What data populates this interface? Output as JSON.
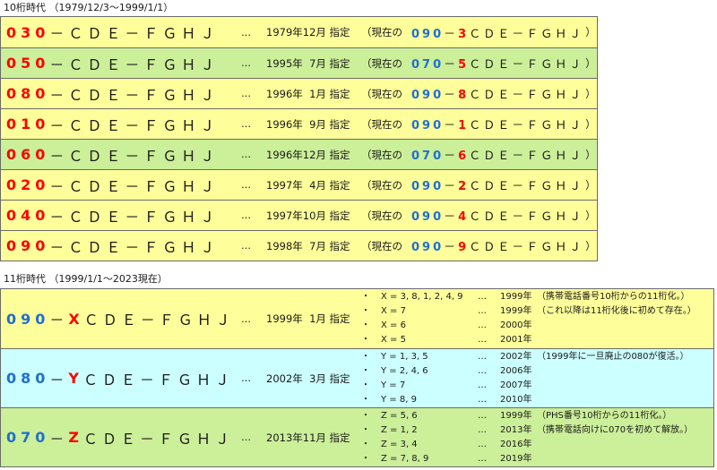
{
  "section10": {
    "heading": "10桁時代 （1979/12/3～1999/1/1）",
    "rows": [
      {
        "prefix": "030",
        "rest": "－ＣＤＥ－ＦＧＨＪ",
        "dots": "…",
        "date": "1979年12月 指定",
        "cur_open": "（現在の",
        "cur_prefix": "090",
        "cur_dash": "－",
        "cur_digit": "3",
        "cur_rest": "ＣＤＥ－ＦＧＨＪ",
        "cur_close": "）",
        "color": "yellow"
      },
      {
        "prefix": "050",
        "rest": "－ＣＤＥ－ＦＧＨＪ",
        "dots": "…",
        "date": "1995年  7月 指定",
        "cur_open": "（現在の",
        "cur_prefix": "070",
        "cur_dash": "－",
        "cur_digit": "5",
        "cur_rest": "ＣＤＥ－ＦＧＨＪ",
        "cur_close": "）",
        "color": "green"
      },
      {
        "prefix": "080",
        "rest": "－ＣＤＥ－ＦＧＨＪ",
        "dots": "…",
        "date": "1996年  1月 指定",
        "cur_open": "（現在の",
        "cur_prefix": "090",
        "cur_dash": "－",
        "cur_digit": "8",
        "cur_rest": "ＣＤＥ－ＦＧＨＪ",
        "cur_close": "）",
        "color": "yellow"
      },
      {
        "prefix": "010",
        "rest": "－ＣＤＥ－ＦＧＨＪ",
        "dots": "…",
        "date": "1996年  9月 指定",
        "cur_open": "（現在の",
        "cur_prefix": "090",
        "cur_dash": "－",
        "cur_digit": "1",
        "cur_rest": "ＣＤＥ－ＦＧＨＪ",
        "cur_close": "）",
        "color": "yellow"
      },
      {
        "prefix": "060",
        "rest": "－ＣＤＥ－ＦＧＨＪ",
        "dots": "…",
        "date": "1996年12月 指定",
        "cur_open": "（現在の",
        "cur_prefix": "070",
        "cur_dash": "－",
        "cur_digit": "6",
        "cur_rest": "ＣＤＥ－ＦＧＨＪ",
        "cur_close": "）",
        "color": "green"
      },
      {
        "prefix": "020",
        "rest": "－ＣＤＥ－ＦＧＨＪ",
        "dots": "…",
        "date": "1997年  4月 指定",
        "cur_open": "（現在の",
        "cur_prefix": "090",
        "cur_dash": "－",
        "cur_digit": "2",
        "cur_rest": "ＣＤＥ－ＦＧＨＪ",
        "cur_close": "）",
        "color": "yellow"
      },
      {
        "prefix": "040",
        "rest": "－ＣＤＥ－ＦＧＨＪ",
        "dots": "…",
        "date": "1997年10月 指定",
        "cur_open": "（現在の",
        "cur_prefix": "090",
        "cur_dash": "－",
        "cur_digit": "4",
        "cur_rest": "ＣＤＥ－ＦＧＨＪ",
        "cur_close": "）",
        "color": "yellow"
      },
      {
        "prefix": "090",
        "rest": "－ＣＤＥ－ＦＧＨＪ",
        "dots": "…",
        "date": "1998年  7月 指定",
        "cur_open": "（現在の",
        "cur_prefix": "090",
        "cur_dash": "－",
        "cur_digit": "9",
        "cur_rest": "ＣＤＥ－ＦＧＨＪ",
        "cur_close": "）",
        "color": "yellow"
      }
    ]
  },
  "section11": {
    "heading": "11桁時代 （1999/1/1～2023現在）",
    "blocks": [
      {
        "prefix": "090",
        "dash": "－",
        "letter": "X",
        "rest": "ＣＤＥ－ＦＧＨＪ",
        "dots": "…",
        "date": "1999年  1月 指定",
        "color": "yellow",
        "subs": [
          {
            "bullet": "・",
            "text": "X = 3, 8, 1, 2, 4, 9",
            "dots": "…",
            "year": "1999年"
          },
          {
            "bullet": "・",
            "text": "X = 7",
            "dots": "…",
            "year": "1999年"
          },
          {
            "bullet": "・",
            "text": "X = 6",
            "dots": "…",
            "year": "2000年"
          },
          {
            "bullet": "・",
            "text": "X = 5",
            "dots": "…",
            "year": "2001年"
          }
        ],
        "notes": [
          "（携帯電話番号10桁からの11桁化。）",
          "（これ以降は11桁化後に初めて存在。）"
        ]
      },
      {
        "prefix": "080",
        "dash": "－",
        "letter": "Y",
        "rest": "ＣＤＥ－ＦＧＨＪ",
        "dots": "…",
        "date": "2002年  3月 指定",
        "color": "cyan",
        "subs": [
          {
            "bullet": "・",
            "text": "Y = 1, 3, 5",
            "dots": "…",
            "year": "2002年"
          },
          {
            "bullet": "・",
            "text": "Y = 2, 4, 6",
            "dots": "…",
            "year": "2006年"
          },
          {
            "bullet": "・",
            "text": "Y = 7",
            "dots": "…",
            "year": "2007年"
          },
          {
            "bullet": "・",
            "text": "Y = 8, 9",
            "dots": "…",
            "year": "2010年"
          }
        ],
        "notes": [
          "（1999年に一旦廃止の080が復活。）"
        ]
      },
      {
        "prefix": "070",
        "dash": "－",
        "letter": "Z",
        "rest": "ＣＤＥ－ＦＧＨＪ",
        "dots": "…",
        "date": "2013年11月 指定",
        "color": "green",
        "subs": [
          {
            "bullet": "・",
            "text": "Z = 5, 6",
            "dots": "…",
            "year": "1999年"
          },
          {
            "bullet": "・",
            "text": "Z = 1, 2",
            "dots": "…",
            "year": "2013年"
          },
          {
            "bullet": "・",
            "text": "Z = 3, 4",
            "dots": "…",
            "year": "2016年"
          },
          {
            "bullet": "・",
            "text": "Z = 7, 8, 9",
            "dots": "…",
            "year": "2019年"
          }
        ],
        "notes": [
          "（PHS番号10桁からの11桁化。）",
          "（携帯電話向けに070を初めて解放。）"
        ]
      }
    ]
  },
  "colors": {
    "red": "#ff0000",
    "blue": "#1f6fd1",
    "yellow": "#fefe9a",
    "green": "#ccef99",
    "cyan": "#ccffff",
    "border": "#6b6b6b"
  }
}
